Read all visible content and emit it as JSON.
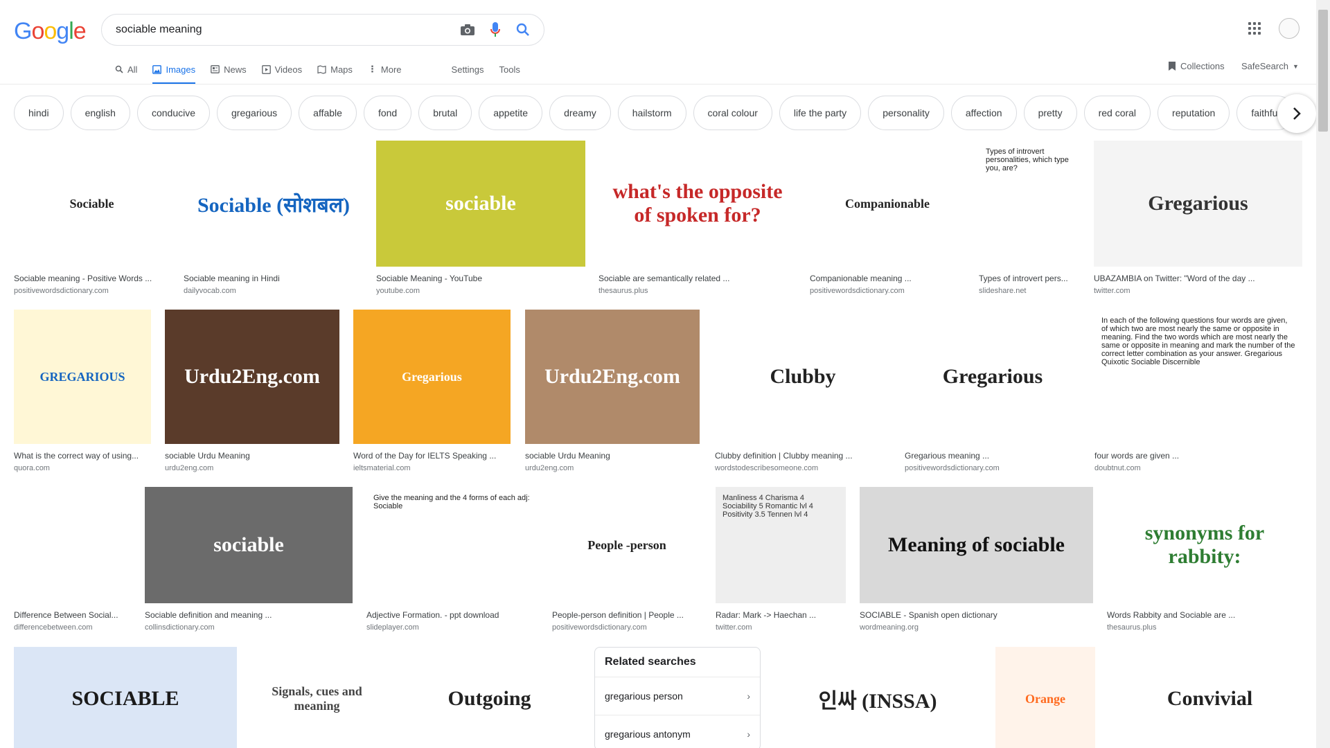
{
  "logo": "Google",
  "search": {
    "query": "sociable meaning"
  },
  "tabs": [
    {
      "label": "All",
      "icon": "search-icon"
    },
    {
      "label": "Images",
      "icon": "image-icon",
      "active": true
    },
    {
      "label": "News",
      "icon": "news-icon"
    },
    {
      "label": "Videos",
      "icon": "video-icon"
    },
    {
      "label": "Maps",
      "icon": "map-icon"
    },
    {
      "label": "More",
      "icon": "more-vert-icon"
    }
  ],
  "tools": {
    "settings": "Settings",
    "tools": "Tools"
  },
  "right_tools": {
    "collections": "Collections",
    "safesearch": "SafeSearch"
  },
  "chips": [
    "hindi",
    "english",
    "conducive",
    "gregarious",
    "affable",
    "fond",
    "brutal",
    "appetite",
    "dreamy",
    "hailstorm",
    "coral colour",
    "life the party",
    "personality",
    "affection",
    "pretty",
    "red coral",
    "reputation",
    "faithful"
  ],
  "results": [
    {
      "thumb_text": "Sociable",
      "title": "Sociable meaning - Positive Words ...",
      "source": "positivewordsdictionary.com",
      "bg": "#ffffff",
      "fg": "#222222"
    },
    {
      "thumb_text": "Sociable (सोशबल)",
      "title": "Sociable meaning in Hindi",
      "source": "dailyvocab.com",
      "bg": "#ffffff",
      "fg": "#1565c0"
    },
    {
      "thumb_text": "sociable",
      "title": "Sociable Meaning - YouTube",
      "source": "youtube.com",
      "bg": "#c9c93a",
      "fg": "#ffffff"
    },
    {
      "thumb_text": "what's the opposite of spoken for?",
      "title": "Sociable are semantically related ...",
      "source": "thesaurus.plus",
      "bg": "#ffffff",
      "fg": "#c62828"
    },
    {
      "thumb_text": "Companionable",
      "title": "Companionable meaning ...",
      "source": "positivewordsdictionary.com",
      "bg": "#ffffff",
      "fg": "#222222"
    },
    {
      "thumb_text": "Types of introvert personalities, which type you, are?",
      "title": "Types of introvert pers...",
      "source": "slideshare.net",
      "bg": "#ffffff",
      "fg": "#222222"
    },
    {
      "thumb_text": "Gregarious",
      "title": "UBAZAMBIA on Twitter: \"Word of the day ...",
      "source": "twitter.com",
      "bg": "#f4f4f4",
      "fg": "#333333"
    },
    {
      "thumb_text": "GREGARIOUS",
      "title": "What is the correct way of using...",
      "source": "quora.com",
      "bg": "#fff7d6",
      "fg": "#1565c0"
    },
    {
      "thumb_text": "Urdu2Eng.com",
      "title": "sociable Urdu Meaning",
      "source": "urdu2eng.com",
      "bg": "#5a3b2a",
      "fg": "#ffffff"
    },
    {
      "thumb_text": "Gregarious",
      "title": "Word of the Day for IELTS Speaking ...",
      "source": "ieltsmaterial.com",
      "bg": "#f5a623",
      "fg": "#ffffff"
    },
    {
      "thumb_text": "Urdu2Eng.com",
      "title": "sociable Urdu Meaning",
      "source": "urdu2eng.com",
      "bg": "#b08a6a",
      "fg": "#ffffff"
    },
    {
      "thumb_text": "Clubby",
      "title": "Clubby definition | Clubby meaning ...",
      "source": "wordstodescribesomeone.com",
      "bg": "#ffffff",
      "fg": "#222222"
    },
    {
      "thumb_text": "Gregarious",
      "title": "Gregarious meaning ...",
      "source": "positivewordsdictionary.com",
      "bg": "#ffffff",
      "fg": "#222222"
    },
    {
      "thumb_text": "In each of the following questions four words are given, of which two are most nearly the same or opposite in meaning. Find the two words which are most nearly the same or opposite in meaning and mark the number of the correct letter combination as your answer. Gregarious Quixotic Sociable Discernible",
      "title": "four words are given ...",
      "source": "doubtnut.com",
      "bg": "#ffffff",
      "fg": "#222222"
    },
    {
      "thumb_text": "",
      "title": "Difference Between Social...",
      "source": "differencebetween.com",
      "bg": "#ffffff",
      "fg": "#222222"
    },
    {
      "thumb_text": "sociable",
      "title": "Sociable definition and meaning ...",
      "source": "collinsdictionary.com",
      "bg": "#6b6b6b",
      "fg": "#ffffff"
    },
    {
      "thumb_text": "Give the meaning and the 4 forms of each adj: Sociable",
      "title": "Adjective Formation. - ppt download",
      "source": "slideplayer.com",
      "bg": "#ffffff",
      "fg": "#222222"
    },
    {
      "thumb_text": "People -person",
      "title": "People-person definition | People ...",
      "source": "positivewordsdictionary.com",
      "bg": "#ffffff",
      "fg": "#222222"
    },
    {
      "thumb_text": "Manliness 4 Charisma 4 Sociability 5 Romantic lvl 4 Positivity 3.5 Tennen lvl 4",
      "title": "Radar: Mark -> Haechan ...",
      "source": "twitter.com",
      "bg": "#eeeeee",
      "fg": "#333333"
    },
    {
      "thumb_text": "Meaning of sociable",
      "title": "SOCIABLE - Spanish open dictionary",
      "source": "wordmeaning.org",
      "bg": "#d9d9d9",
      "fg": "#111111"
    },
    {
      "thumb_text": "synonyms for rabbity:",
      "title": "Words Rabbity and Sociable are ...",
      "source": "thesaurus.plus",
      "bg": "#ffffff",
      "fg": "#2e7d32"
    },
    {
      "thumb_text": "SOCIABLE",
      "title": "",
      "source": "",
      "bg": "#dbe6f6",
      "fg": "#1a1a1a"
    },
    {
      "thumb_text": "Signals, cues and meaning",
      "title": "",
      "source": "",
      "bg": "#ffffff",
      "fg": "#444444"
    },
    {
      "thumb_text": "Outgoing",
      "title": "",
      "source": "",
      "bg": "#ffffff",
      "fg": "#222222"
    },
    {
      "thumb_text": "인싸 (INSSA)",
      "title": "",
      "source": "",
      "bg": "#ffffff",
      "fg": "#222222"
    },
    {
      "thumb_text": "Orange",
      "title": "",
      "source": "",
      "bg": "#fff3ea",
      "fg": "#ff6a1f"
    },
    {
      "thumb_text": "Convivial",
      "title": "",
      "source": "",
      "bg": "#ffffff",
      "fg": "#222222"
    }
  ],
  "related": {
    "title": "Related searches",
    "items": [
      "gregarious person",
      "gregarious antonym"
    ]
  },
  "colors": {
    "blue": "#4285f4",
    "red": "#ea4335",
    "yellow": "#fbbc05",
    "green": "#34a853",
    "link": "#1a73e8"
  }
}
